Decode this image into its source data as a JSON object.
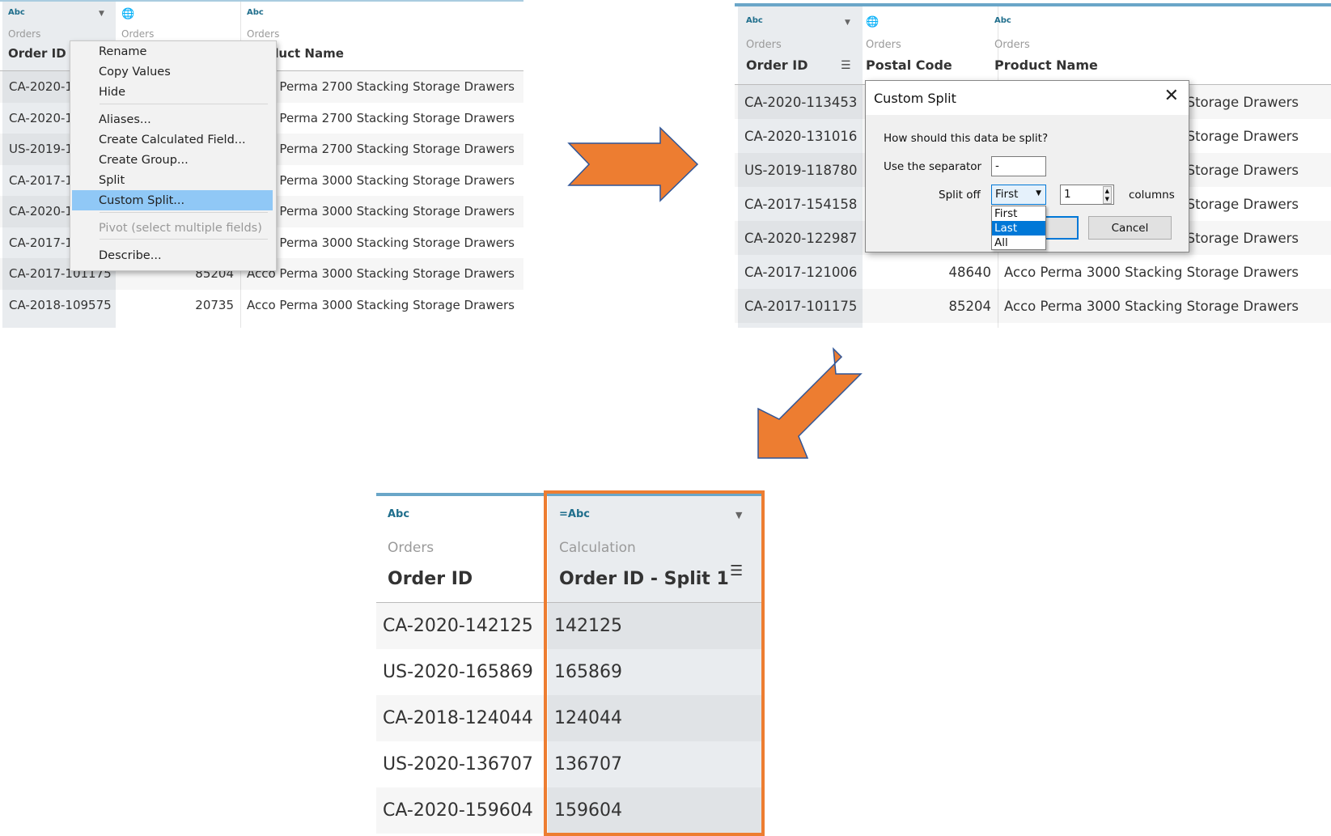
{
  "colors": {
    "accent": "#ed7d31",
    "header_bar": "#6aa6c8",
    "selection": "#90c8f6",
    "list_selection": "#0078d7"
  },
  "panel1": {
    "columns": [
      {
        "type": "Abc",
        "source": "Orders",
        "name": "Order ID"
      },
      {
        "type": "globe-icon",
        "source": "Orders",
        "name": "Postal Code"
      },
      {
        "type": "Abc",
        "source": "Orders",
        "name": "Product Name"
      }
    ],
    "rows": [
      [
        "CA-2020-113453",
        "",
        "Acco Perma 2700 Stacking Storage Drawers"
      ],
      [
        "CA-2020-131016",
        "",
        "Acco Perma 2700 Stacking Storage Drawers"
      ],
      [
        "US-2019-118780",
        "",
        "Acco Perma 2700 Stacking Storage Drawers"
      ],
      [
        "CA-2017-154158",
        "",
        "Acco Perma 3000 Stacking Storage Drawers"
      ],
      [
        "CA-2020-122987",
        "",
        "Acco Perma 3000 Stacking Storage Drawers"
      ],
      [
        "CA-2017-121006",
        "",
        "Acco Perma 3000 Stacking Storage Drawers"
      ],
      [
        "CA-2017-101175",
        "85204",
        "Acco Perma 3000 Stacking Storage Drawers"
      ],
      [
        "CA-2018-109575",
        "20735",
        "Acco Perma 3000 Stacking Storage Drawers"
      ]
    ],
    "menu": {
      "items": [
        {
          "label": "Rename"
        },
        {
          "label": "Copy Values"
        },
        {
          "label": "Hide"
        },
        {
          "label": "Aliases..."
        },
        {
          "label": "Create Calculated Field..."
        },
        {
          "label": "Create Group..."
        },
        {
          "label": "Split"
        },
        {
          "label": "Custom Split...",
          "selected": true
        },
        {
          "label": "Pivot (select multiple fields)",
          "disabled": true
        },
        {
          "label": "Describe..."
        }
      ]
    }
  },
  "panel2": {
    "columns": [
      {
        "type": "Abc",
        "source": "Orders",
        "name": "Order ID"
      },
      {
        "type": "globe-icon",
        "source": "Orders",
        "name": "Postal Code"
      },
      {
        "type": "Abc",
        "source": "Orders",
        "name": "Product Name"
      }
    ],
    "rows": [
      [
        "CA-2020-113453",
        "",
        "Acco Perma 2700 Stacking Storage Drawers"
      ],
      [
        "CA-2020-131016",
        "",
        "Acco Perma 2700 Stacking Storage Drawers"
      ],
      [
        "US-2019-118780",
        "",
        "Acco Perma 2700 Stacking Storage Drawers"
      ],
      [
        "CA-2017-154158",
        "",
        "Acco Perma 3000 Stacking Storage Drawers"
      ],
      [
        "CA-2020-122987",
        "",
        "Acco Perma 3000 Stacking Storage Drawers"
      ],
      [
        "CA-2017-121006",
        "48640",
        "Acco Perma 3000 Stacking Storage Drawers"
      ],
      [
        "CA-2017-101175",
        "85204",
        "Acco Perma 3000 Stacking Storage Drawers"
      ]
    ],
    "dialog": {
      "title": "Custom Split",
      "question": "How should this data be split?",
      "separator_label": "Use the separator",
      "separator_value": "-",
      "split_off_label": "Split off",
      "split_off_value": "First",
      "split_off_options": [
        "First",
        "Last",
        "All"
      ],
      "highlighted_option": "Last",
      "columns_value": "1",
      "columns_label": "columns",
      "cancel_label": "Cancel"
    }
  },
  "panel3": {
    "columns": [
      {
        "type": "Abc",
        "source": "Orders",
        "name": "Order ID"
      },
      {
        "type": "=Abc",
        "source": "Calculation",
        "name": "Order ID - Split 1"
      }
    ],
    "rows": [
      [
        "CA-2020-142125",
        "142125"
      ],
      [
        "US-2020-165869",
        "165869"
      ],
      [
        "CA-2018-124044",
        "124044"
      ],
      [
        "US-2020-136707",
        "136707"
      ],
      [
        "CA-2020-159604",
        "159604"
      ]
    ]
  }
}
